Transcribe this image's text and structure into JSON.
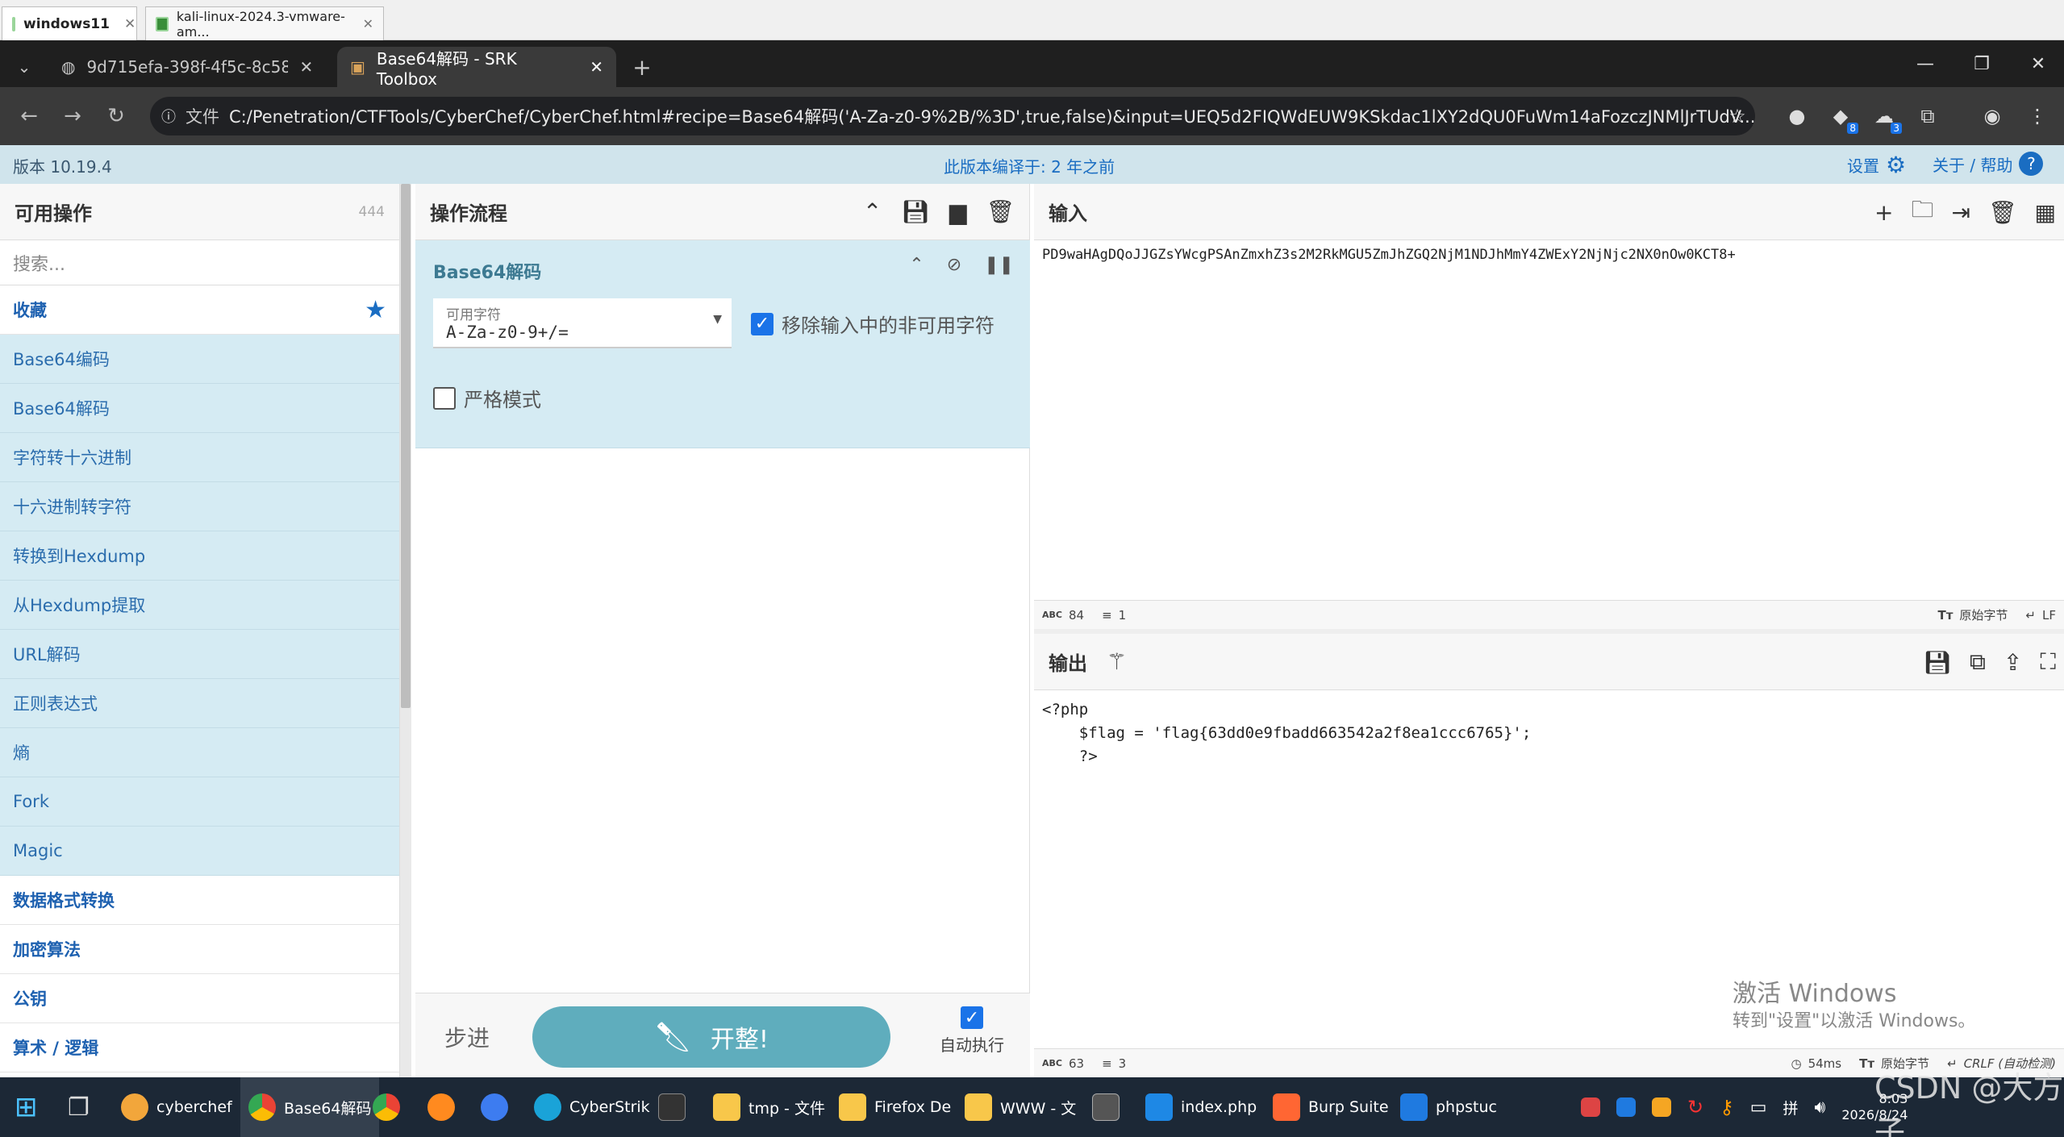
{
  "vm_tabs": [
    {
      "label": "windows11",
      "active": true
    },
    {
      "label": "kali-linux-2024.3-vmware-am...",
      "active": false
    }
  ],
  "browser_tabs": [
    {
      "label": "9d715efa-398f-4f5c-8c58-a6",
      "active": false
    },
    {
      "label": "Base64解码 - SRK Toolbox",
      "active": true
    }
  ],
  "address": {
    "scheme_label": "文件",
    "url": "C:/Penetration/CTFTools/CyberChef/CyberChef.html#recipe=Base64解码('A-Za-z0-9%2B/%3D',true,false)&input=UEQ5d2FIQWdEUW9KSkdac1lXY2dQU0FuWm14aFozczJNMlJrTUdV..."
  },
  "extensions": [
    {
      "badge": "8"
    },
    {
      "badge": "3"
    }
  ],
  "banner": {
    "version": "版本 10.19.4",
    "compiled": "此版本编译于: 2 年之前",
    "settings": "设置",
    "about": "关于 / 帮助"
  },
  "ops": {
    "title": "可用操作",
    "count": "444",
    "search_placeholder": "搜索...",
    "favourites": "收藏",
    "items": [
      "Base64编码",
      "Base64解码",
      "字符转十六进制",
      "十六进制转字符",
      "转换到Hexdump",
      "从Hexdump提取",
      "URL解码",
      "正则表达式",
      "熵",
      "Fork",
      "Magic"
    ],
    "categories": [
      "数据格式转换",
      "加密算法",
      "公钥",
      "算术 / 逻辑"
    ]
  },
  "recipe": {
    "title": "操作流程",
    "op_name": "Base64解码",
    "alphabet_label": "可用字符",
    "alphabet_value": "A-Za-z0-9+/=",
    "remove_nonalpha": "移除输入中的非可用字符",
    "strict_mode": "严格模式",
    "step": "步进",
    "bake": "开整!",
    "autobake": "自动执行"
  },
  "input": {
    "title": "输入",
    "text": "PD9waHAgDQoJJGZsYWcgPSAnZmxhZ3s2M2RkMGU5ZmJhZGQ2NjM1NDJhMmY4ZWExY2NjNjc2NX0nOw0KCT8+",
    "length": "84",
    "lines": "1",
    "raw_bytes": "原始字节",
    "eol": "LF"
  },
  "output": {
    "title": "输出",
    "lines": [
      "<?php",
      "    $flag = 'flag{63dd0e9fbadd663542a2f8ea1ccc6765}';",
      "    ?>"
    ],
    "length": "63",
    "line_count": "3",
    "time": "54ms",
    "raw_bytes": "原始字节",
    "eol": "CRLF (自动检测)"
  },
  "watermark": {
    "line1": "激活 Windows",
    "line2": "转到\"设置\"以激活 Windows。"
  },
  "taskbar": {
    "apps": [
      "cyberchef",
      "Base64解码",
      "CyberStrik",
      "tmp - 文件",
      "Firefox De",
      "WWW - 文",
      "index.php",
      "Burp Suite",
      "phpstuc"
    ],
    "lang": "拼",
    "time": "8:03",
    "date": "2026/8/24",
    "csdn": "CSDN @大方子"
  }
}
